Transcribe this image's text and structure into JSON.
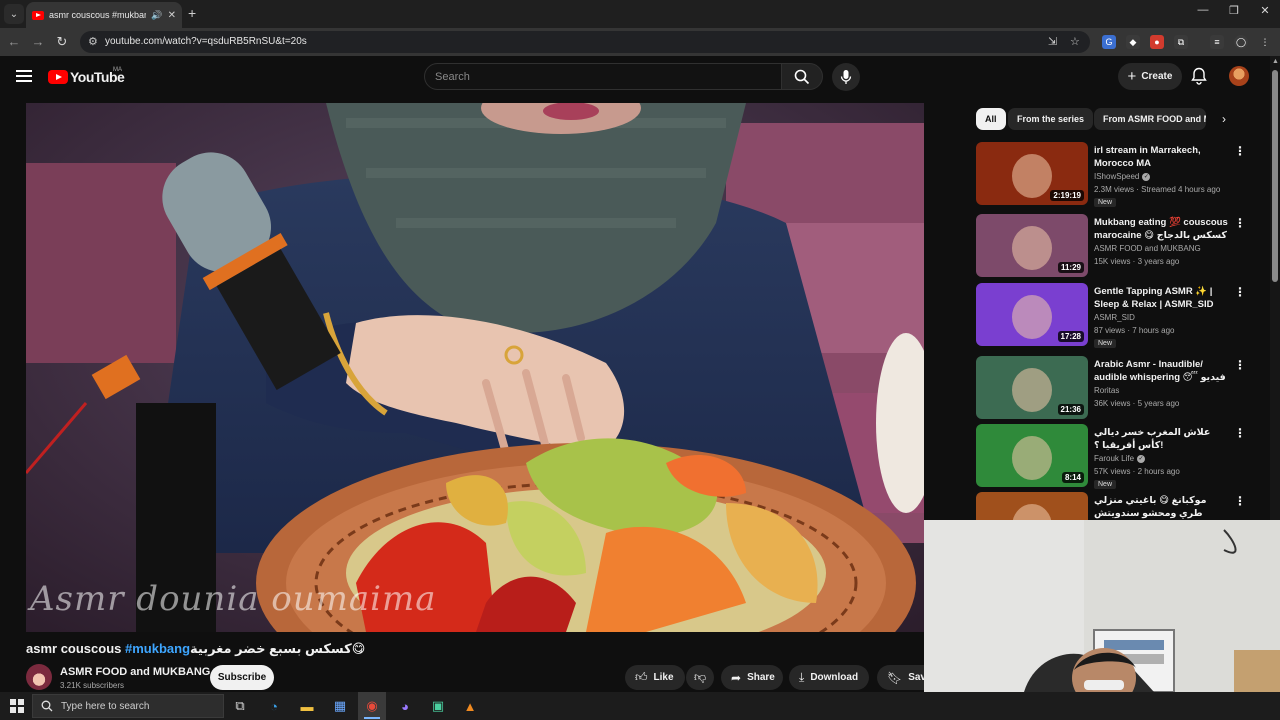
{
  "browser": {
    "tab_title": "asmr couscous #mukbang",
    "url": "youtube.com/watch?v=qsduRB5RnSU&t=20s"
  },
  "youtube": {
    "logo_text": "YouTube",
    "country_code": "MA",
    "search_placeholder": "Search",
    "create_label": "Create"
  },
  "video": {
    "watermark": "Asmr dounia oumaima",
    "title_prefix": "asmr couscous ",
    "title_hashtag": "#mukbang",
    "title_suffix": "كسكس بسبع خضر مغربية😋",
    "channel_name": "ASMR FOOD and MUKBANG",
    "subscribers": "3.21K subscribers",
    "subscribe_label": "Subscribe",
    "like_label": "Like",
    "share_label": "Share",
    "download_label": "Download",
    "save_label": "Save"
  },
  "chips": [
    {
      "label": "All"
    },
    {
      "label": "From the series"
    },
    {
      "label": "From ASMR FOOD and M"
    }
  ],
  "recommendations": [
    {
      "title": "irl stream in Marrakech, Morocco MA",
      "channel": "IShowSpeed",
      "verified": true,
      "meta": "2.3M views · Streamed 4 hours ago",
      "badge": "New",
      "duration": "2:19:19",
      "thumb_color": "#8a2a10"
    },
    {
      "title": "Mukbang eating 💯 couscous marocaine 😋 كسكس بالدجاج و ...",
      "channel": "ASMR FOOD and MUKBANG",
      "verified": false,
      "meta": "15K views · 3 years ago",
      "badge": "",
      "duration": "11:29",
      "thumb_color": "#7d4a6a"
    },
    {
      "title": "Gentle Tapping ASMR ✨ | Sleep & Relax | ASMR_SID",
      "channel": "ASMR_SID",
      "verified": false,
      "meta": "87 views · 7 hours ago",
      "badge": "New",
      "duration": "17:28",
      "thumb_color": "#7a3fd0"
    },
    {
      "title": "Arabic Asmr - Inaudible/ audible whispering 😴 فيديو يساعدك على ...",
      "channel": "Roritas",
      "verified": false,
      "meta": "36K views · 5 years ago",
      "badge": "",
      "duration": "21:36",
      "thumb_color": "#3c6b52"
    },
    {
      "title": "علاش المغرب خسر ديالي كأس أفريقيا ؟!",
      "channel": "Farouk Life",
      "verified": true,
      "meta": "57K views · 2 hours ago",
      "badge": "New",
      "duration": "8:14",
      "thumb_color": "#2f8a3a"
    },
    {
      "title": "موكبانغ 😋 باغيتي منزلي طري ومحشو سندويتش سلخن ولذيذ 😋 ...",
      "channel": "",
      "verified": false,
      "meta": "",
      "badge": "",
      "duration": "",
      "thumb_color": "#a0501c"
    }
  ],
  "taskbar": {
    "search_placeholder": "Type here to search"
  }
}
